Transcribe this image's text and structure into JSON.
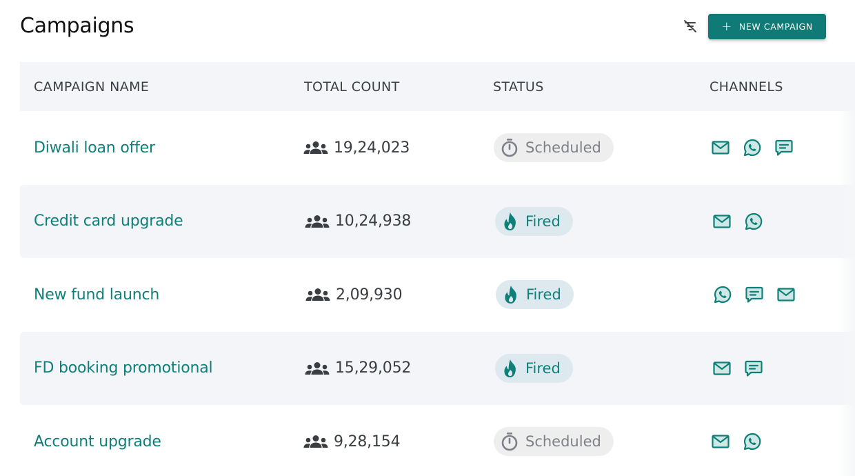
{
  "page": {
    "title": "Campaigns"
  },
  "toolbar": {
    "new_campaign_label": "NEW CAMPAIGN"
  },
  "table": {
    "columns": [
      "CAMPAIGN NAME",
      "TOTAL COUNT",
      "STATUS",
      "CHANNELS"
    ],
    "rows": [
      {
        "name": "Diwali loan offer",
        "count": "19,24,023",
        "status": "Scheduled",
        "channels": [
          "email-icon",
          "whatsapp-icon",
          "sms-icon"
        ]
      },
      {
        "name": "Credit card upgrade",
        "count": "10,24,938",
        "status": "Fired",
        "channels": [
          "email-icon",
          "whatsapp-icon"
        ]
      },
      {
        "name": "New fund launch",
        "count": "2,09,930",
        "status": "Fired",
        "channels": [
          "whatsapp-icon",
          "sms-icon",
          "email-icon"
        ]
      },
      {
        "name": "FD booking promotional",
        "count": "15,29,052",
        "status": "Fired",
        "channels": [
          "email-icon",
          "sms-icon"
        ]
      },
      {
        "name": "Account upgrade",
        "count": "9,28,154",
        "status": "Scheduled",
        "channels": [
          "email-icon",
          "whatsapp-icon"
        ]
      }
    ]
  },
  "colors": {
    "accent": "#0f7a76",
    "row_alt": "#f3f5f8",
    "scheduled_bg": "#eeeeef",
    "fired_bg": "#dde9ee"
  }
}
